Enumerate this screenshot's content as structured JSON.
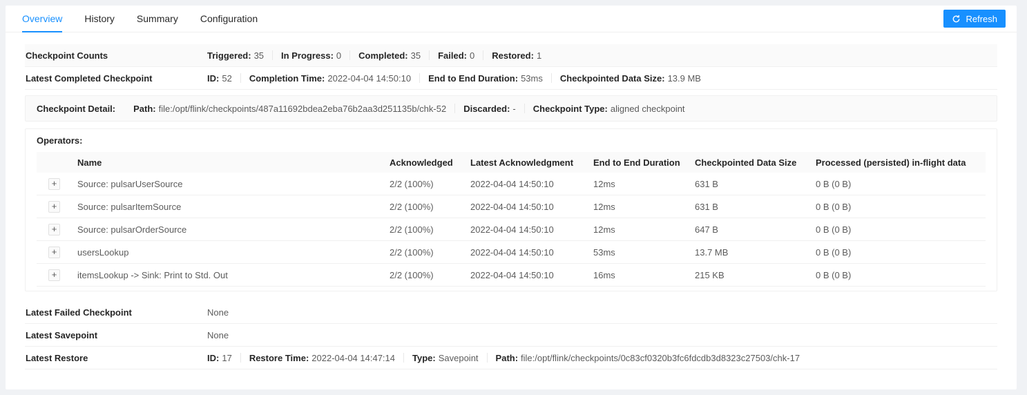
{
  "colors": {
    "accent": "#1890ff",
    "border": "#f0f0f0",
    "shaded_bg": "#fafafa"
  },
  "tabs": [
    {
      "label": "Overview",
      "active": true
    },
    {
      "label": "History",
      "active": false
    },
    {
      "label": "Summary",
      "active": false
    },
    {
      "label": "Configuration",
      "active": false
    }
  ],
  "refresh": {
    "label": "Refresh",
    "icon": "sync-icon"
  },
  "summary": [
    {
      "label": "Checkpoint Counts",
      "items": [
        {
          "k": "Triggered:",
          "v": "35"
        },
        {
          "k": "In Progress:",
          "v": "0"
        },
        {
          "k": "Completed:",
          "v": "35"
        },
        {
          "k": "Failed:",
          "v": "0"
        },
        {
          "k": "Restored:",
          "v": "1"
        }
      ]
    },
    {
      "label": "Latest Completed Checkpoint",
      "items": [
        {
          "k": "ID:",
          "v": "52"
        },
        {
          "k": "Completion Time:",
          "v": "2022-04-04 14:50:10"
        },
        {
          "k": "End to End Duration:",
          "v": "53ms"
        },
        {
          "k": "Checkpointed Data Size:",
          "v": "13.9 MB"
        }
      ]
    }
  ],
  "detail": {
    "label": "Checkpoint Detail:",
    "items": [
      {
        "k": "Path:",
        "v": "file:/opt/flink/checkpoints/487a11692bdea2eba76b2aa3d251135b/chk-52"
      },
      {
        "k": "Discarded:",
        "v": "-"
      },
      {
        "k": "Checkpoint Type:",
        "v": "aligned checkpoint"
      }
    ]
  },
  "operators": {
    "title": "Operators:",
    "expand_symbol": "+",
    "columns": {
      "name": "Name",
      "acknowledged": "Acknowledged",
      "latest_ack": "Latest Acknowledgment",
      "e2e_duration": "End to End Duration",
      "data_size": "Checkpointed Data Size",
      "inflight": "Processed (persisted) in-flight data"
    },
    "rows": [
      {
        "name": "Source: pulsarUserSource",
        "acknowledged": "2/2 (100%)",
        "latest_ack": "2022-04-04 14:50:10",
        "e2e_duration": "12ms",
        "data_size": "631 B",
        "inflight": "0 B (0 B)"
      },
      {
        "name": "Source: pulsarItemSource",
        "acknowledged": "2/2 (100%)",
        "latest_ack": "2022-04-04 14:50:10",
        "e2e_duration": "12ms",
        "data_size": "631 B",
        "inflight": "0 B (0 B)"
      },
      {
        "name": "Source: pulsarOrderSource",
        "acknowledged": "2/2 (100%)",
        "latest_ack": "2022-04-04 14:50:10",
        "e2e_duration": "12ms",
        "data_size": "647 B",
        "inflight": "0 B (0 B)"
      },
      {
        "name": "usersLookup",
        "acknowledged": "2/2 (100%)",
        "latest_ack": "2022-04-04 14:50:10",
        "e2e_duration": "53ms",
        "data_size": "13.7 MB",
        "inflight": "0 B (0 B)"
      },
      {
        "name": "itemsLookup -> Sink: Print to Std. Out",
        "acknowledged": "2/2 (100%)",
        "latest_ack": "2022-04-04 14:50:10",
        "e2e_duration": "16ms",
        "data_size": "215 KB",
        "inflight": "0 B (0 B)"
      }
    ]
  },
  "footer": [
    {
      "label": "Latest Failed Checkpoint",
      "value": "None"
    },
    {
      "label": "Latest Savepoint",
      "value": "None"
    },
    {
      "label": "Latest Restore",
      "items": [
        {
          "k": "ID:",
          "v": "17"
        },
        {
          "k": "Restore Time:",
          "v": "2022-04-04 14:47:14"
        },
        {
          "k": "Type:",
          "v": "Savepoint"
        },
        {
          "k": "Path:",
          "v": "file:/opt/flink/checkpoints/0c83cf0320b3fc6fdcdb3d8323c27503/chk-17"
        }
      ]
    }
  ]
}
